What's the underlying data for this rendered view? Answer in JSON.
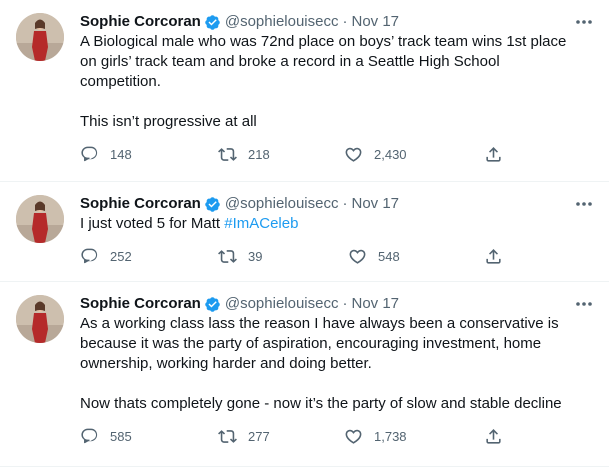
{
  "tweets": [
    {
      "author_name": "Sophie Corcoran",
      "handle": "@sophielouisecc",
      "separator": "·",
      "date": "Nov 17",
      "text": "A Biological male who was 72nd place on boys’ track team wins 1st place on girls’ track team and broke a record in a Seattle High School competition.\n\nThis isn’t progressive at all",
      "hashtag": "",
      "replies": "148",
      "retweets": "218",
      "likes": "2,430"
    },
    {
      "author_name": "Sophie Corcoran",
      "handle": "@sophielouisecc",
      "separator": "·",
      "date": "Nov 17",
      "text": "I just voted 5 for Matt ",
      "hashtag": "#ImACeleb",
      "replies": "252",
      "retweets": "39",
      "likes": "548"
    },
    {
      "author_name": "Sophie Corcoran",
      "handle": "@sophielouisecc",
      "separator": "·",
      "date": "Nov 17",
      "text": "As a working class lass the reason I have always been a conservative is because it was the party of aspiration, encouraging investment, home ownership, working harder and doing better.\n\nNow thats completely gone - now it’s the party of slow and stable decline",
      "hashtag": "",
      "replies": "585",
      "retweets": "277",
      "likes": "1,738"
    }
  ],
  "icons": {
    "verified": "verified-badge-icon",
    "more": "more-options-icon",
    "reply": "reply-icon",
    "retweet": "retweet-icon",
    "like": "like-icon",
    "share": "share-icon"
  },
  "colors": {
    "text": "#0f1419",
    "secondary": "#536471",
    "accent": "#1d9bf0",
    "divider": "#eff3f4"
  }
}
